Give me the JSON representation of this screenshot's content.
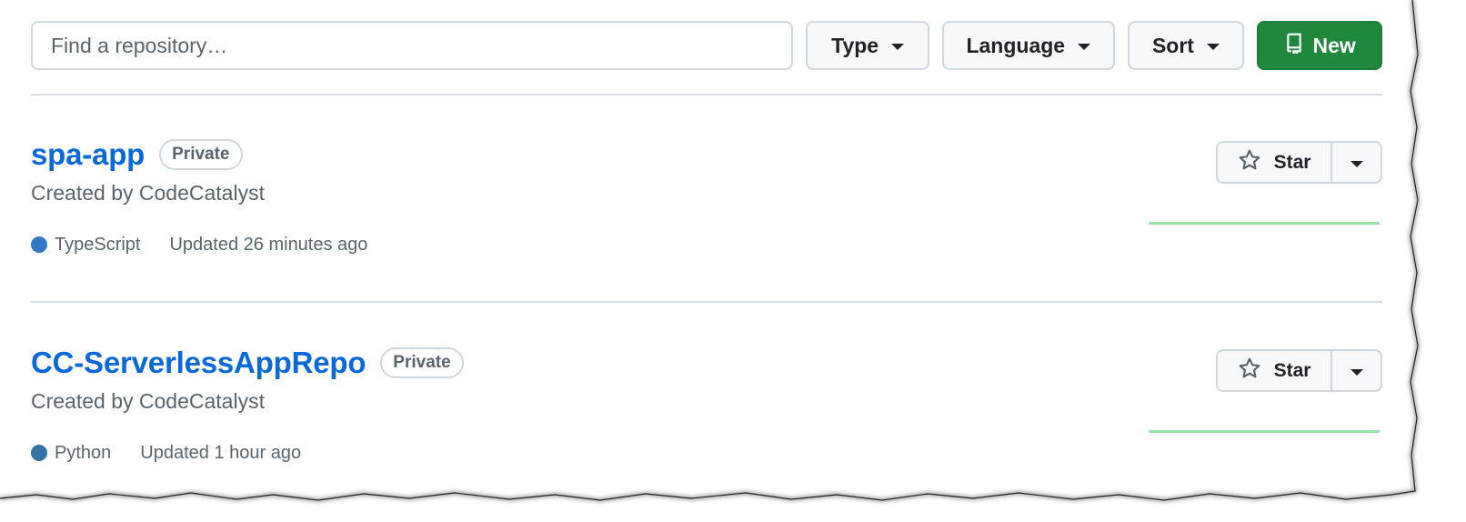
{
  "toolbar": {
    "search_placeholder": "Find a repository…",
    "type_label": "Type",
    "language_label": "Language",
    "sort_label": "Sort",
    "new_label": "New"
  },
  "repos": [
    {
      "name": "spa-app",
      "visibility": "Private",
      "description": "Created by CodeCatalyst",
      "language": "TypeScript",
      "language_color": "#3178c6",
      "updated": "Updated 26 minutes ago",
      "star_label": "Star"
    },
    {
      "name": "CC-ServerlessAppRepo",
      "visibility": "Private",
      "description": "Created by CodeCatalyst",
      "language": "Python",
      "language_color": "#3572A5",
      "updated": "Updated 1 hour ago",
      "star_label": "Star"
    }
  ],
  "colors": {
    "link": "#0969da",
    "primary_button": "#1f883d",
    "activity_graph": "#94e2a4"
  }
}
